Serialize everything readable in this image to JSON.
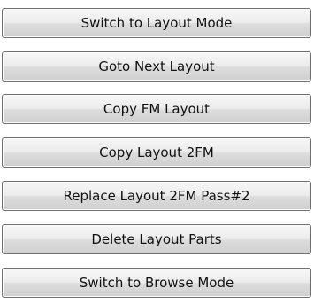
{
  "buttons": [
    {
      "label": "Switch to Layout Mode"
    },
    {
      "label": "Goto Next Layout"
    },
    {
      "label": "Copy FM Layout"
    },
    {
      "label": "Copy Layout 2FM"
    },
    {
      "label": "Replace Layout 2FM Pass#2"
    },
    {
      "label": "Delete Layout Parts"
    },
    {
      "label": "Switch to Browse Mode"
    }
  ]
}
